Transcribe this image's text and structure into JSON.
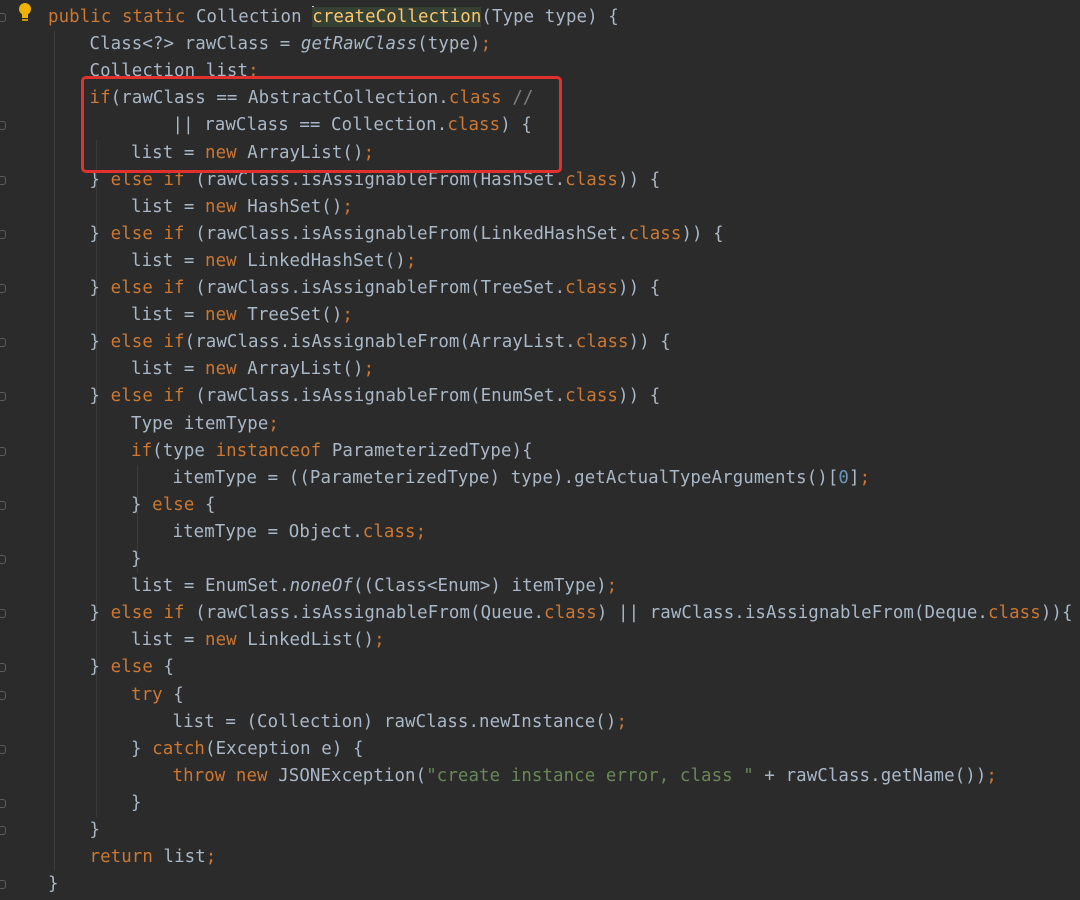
{
  "editor": {
    "lines": [
      {
        "indent": 0,
        "tokens": [
          {
            "t": "public static ",
            "c": "keyword"
          },
          {
            "t": "Collection "
          },
          {
            "t": "createCollection",
            "c": "method-decl highlight",
            "caret": true
          },
          {
            "t": "(Type type) {"
          }
        ]
      },
      {
        "indent": 1,
        "tokens": [
          {
            "t": "Class<?> rawClass = "
          },
          {
            "t": "getRawClass",
            "c": "italic"
          },
          {
            "t": "(type)"
          },
          {
            "t": ";",
            "c": "keyword"
          }
        ]
      },
      {
        "indent": 1,
        "tokens": [
          {
            "t": "Collection list"
          },
          {
            "t": ";",
            "c": "keyword"
          }
        ]
      },
      {
        "indent": 1,
        "tokens": [
          {
            "t": "if",
            "c": "keyword"
          },
          {
            "t": "(rawClass == AbstractCollection."
          },
          {
            "t": "class ",
            "c": "keyword"
          },
          {
            "t": "//",
            "c": "comment"
          }
        ]
      },
      {
        "indent": 3,
        "tokens": [
          {
            "t": "|| rawClass == Collection."
          },
          {
            "t": "class",
            "c": "keyword"
          },
          {
            "t": ") {"
          }
        ]
      },
      {
        "indent": 2,
        "tokens": [
          {
            "t": "list = "
          },
          {
            "t": "new ",
            "c": "keyword"
          },
          {
            "t": "ArrayList()"
          },
          {
            "t": ";",
            "c": "keyword"
          }
        ]
      },
      {
        "indent": 1,
        "tokens": [
          {
            "t": "} "
          },
          {
            "t": "else if ",
            "c": "keyword"
          },
          {
            "t": "(rawClass.isAssignableFrom(HashSet."
          },
          {
            "t": "class",
            "c": "keyword"
          },
          {
            "t": ")) {"
          }
        ]
      },
      {
        "indent": 2,
        "tokens": [
          {
            "t": "list = "
          },
          {
            "t": "new ",
            "c": "keyword"
          },
          {
            "t": "HashSet()"
          },
          {
            "t": ";",
            "c": "keyword"
          }
        ]
      },
      {
        "indent": 1,
        "tokens": [
          {
            "t": "} "
          },
          {
            "t": "else if ",
            "c": "keyword"
          },
          {
            "t": "(rawClass.isAssignableFrom(LinkedHashSet."
          },
          {
            "t": "class",
            "c": "keyword"
          },
          {
            "t": ")) {"
          }
        ]
      },
      {
        "indent": 2,
        "tokens": [
          {
            "t": "list = "
          },
          {
            "t": "new ",
            "c": "keyword"
          },
          {
            "t": "LinkedHashSet()"
          },
          {
            "t": ";",
            "c": "keyword"
          }
        ]
      },
      {
        "indent": 1,
        "tokens": [
          {
            "t": "} "
          },
          {
            "t": "else if ",
            "c": "keyword"
          },
          {
            "t": "(rawClass.isAssignableFrom(TreeSet."
          },
          {
            "t": "class",
            "c": "keyword"
          },
          {
            "t": ")) {"
          }
        ]
      },
      {
        "indent": 2,
        "tokens": [
          {
            "t": "list = "
          },
          {
            "t": "new ",
            "c": "keyword"
          },
          {
            "t": "TreeSet()"
          },
          {
            "t": ";",
            "c": "keyword"
          }
        ]
      },
      {
        "indent": 1,
        "tokens": [
          {
            "t": "} "
          },
          {
            "t": "else if",
            "c": "keyword"
          },
          {
            "t": "(rawClass.isAssignableFrom(ArrayList."
          },
          {
            "t": "class",
            "c": "keyword"
          },
          {
            "t": ")) {"
          }
        ]
      },
      {
        "indent": 2,
        "tokens": [
          {
            "t": "list = "
          },
          {
            "t": "new ",
            "c": "keyword"
          },
          {
            "t": "ArrayList()"
          },
          {
            "t": ";",
            "c": "keyword"
          }
        ]
      },
      {
        "indent": 1,
        "tokens": [
          {
            "t": "} "
          },
          {
            "t": "else if ",
            "c": "keyword"
          },
          {
            "t": "(rawClass.isAssignableFrom(EnumSet."
          },
          {
            "t": "class",
            "c": "keyword"
          },
          {
            "t": ")) {"
          }
        ]
      },
      {
        "indent": 2,
        "tokens": [
          {
            "t": "Type itemType"
          },
          {
            "t": ";",
            "c": "keyword"
          }
        ]
      },
      {
        "indent": 2,
        "tokens": [
          {
            "t": "if",
            "c": "keyword"
          },
          {
            "t": "(type "
          },
          {
            "t": "instanceof ",
            "c": "keyword"
          },
          {
            "t": "ParameterizedType){"
          }
        ]
      },
      {
        "indent": 3,
        "tokens": [
          {
            "t": "itemType = ((ParameterizedType) type).getActualTypeArguments()["
          },
          {
            "t": "0",
            "c": "number"
          },
          {
            "t": "]"
          },
          {
            "t": ";",
            "c": "keyword"
          }
        ]
      },
      {
        "indent": 2,
        "tokens": [
          {
            "t": "} "
          },
          {
            "t": "else ",
            "c": "keyword"
          },
          {
            "t": "{"
          }
        ]
      },
      {
        "indent": 3,
        "tokens": [
          {
            "t": "itemType = Object."
          },
          {
            "t": "class",
            "c": "keyword"
          },
          {
            "t": ";",
            "c": "keyword"
          }
        ]
      },
      {
        "indent": 2,
        "tokens": [
          {
            "t": "}"
          }
        ]
      },
      {
        "indent": 2,
        "tokens": [
          {
            "t": "list = EnumSet."
          },
          {
            "t": "noneOf",
            "c": "italic"
          },
          {
            "t": "((Class<Enum>) itemType)"
          },
          {
            "t": ";",
            "c": "keyword"
          }
        ]
      },
      {
        "indent": 1,
        "tokens": [
          {
            "t": "} "
          },
          {
            "t": "else if ",
            "c": "keyword"
          },
          {
            "t": "(rawClass.isAssignableFrom(Queue."
          },
          {
            "t": "class",
            "c": "keyword"
          },
          {
            "t": ") || rawClass.isAssignableFrom(Deque."
          },
          {
            "t": "class",
            "c": "keyword"
          },
          {
            "t": ")){"
          }
        ]
      },
      {
        "indent": 2,
        "tokens": [
          {
            "t": "list = "
          },
          {
            "t": "new ",
            "c": "keyword"
          },
          {
            "t": "LinkedList()"
          },
          {
            "t": ";",
            "c": "keyword"
          }
        ]
      },
      {
        "indent": 1,
        "tokens": [
          {
            "t": "} "
          },
          {
            "t": "else ",
            "c": "keyword"
          },
          {
            "t": "{"
          }
        ]
      },
      {
        "indent": 2,
        "tokens": [
          {
            "t": "try ",
            "c": "keyword"
          },
          {
            "t": "{"
          }
        ]
      },
      {
        "indent": 3,
        "tokens": [
          {
            "t": "list = (Collection) rawClass.newInstance()"
          },
          {
            "t": ";",
            "c": "keyword"
          }
        ]
      },
      {
        "indent": 2,
        "tokens": [
          {
            "t": "} "
          },
          {
            "t": "catch",
            "c": "keyword"
          },
          {
            "t": "(Exception e) {"
          }
        ]
      },
      {
        "indent": 3,
        "tokens": [
          {
            "t": "throw new ",
            "c": "keyword"
          },
          {
            "t": "JSONException("
          },
          {
            "t": "\"create instance error, class \"",
            "c": "string"
          },
          {
            "t": " + rawClass.getName())"
          },
          {
            "t": ";",
            "c": "keyword"
          }
        ]
      },
      {
        "indent": 2,
        "tokens": [
          {
            "t": "}"
          }
        ]
      },
      {
        "indent": 1,
        "tokens": [
          {
            "t": "}"
          }
        ]
      },
      {
        "indent": 1,
        "tokens": [
          {
            "t": "return ",
            "c": "keyword"
          },
          {
            "t": "list"
          },
          {
            "t": ";",
            "c": "keyword"
          }
        ]
      },
      {
        "indent": 0,
        "tokens": [
          {
            "t": "}"
          }
        ]
      }
    ]
  },
  "annotation": {
    "color": "#e0312f"
  },
  "colors": {
    "background": "#2b2b2b",
    "text": "#a9b7c6",
    "keyword": "#cc7832",
    "method_declaration": "#ffc66d",
    "number": "#6897bb",
    "string": "#6a8759",
    "comment": "#808080",
    "intention_bulb": "#f0b100"
  },
  "icons": {
    "intention": "lightbulb-icon",
    "fold": "fold-marker-icon"
  }
}
